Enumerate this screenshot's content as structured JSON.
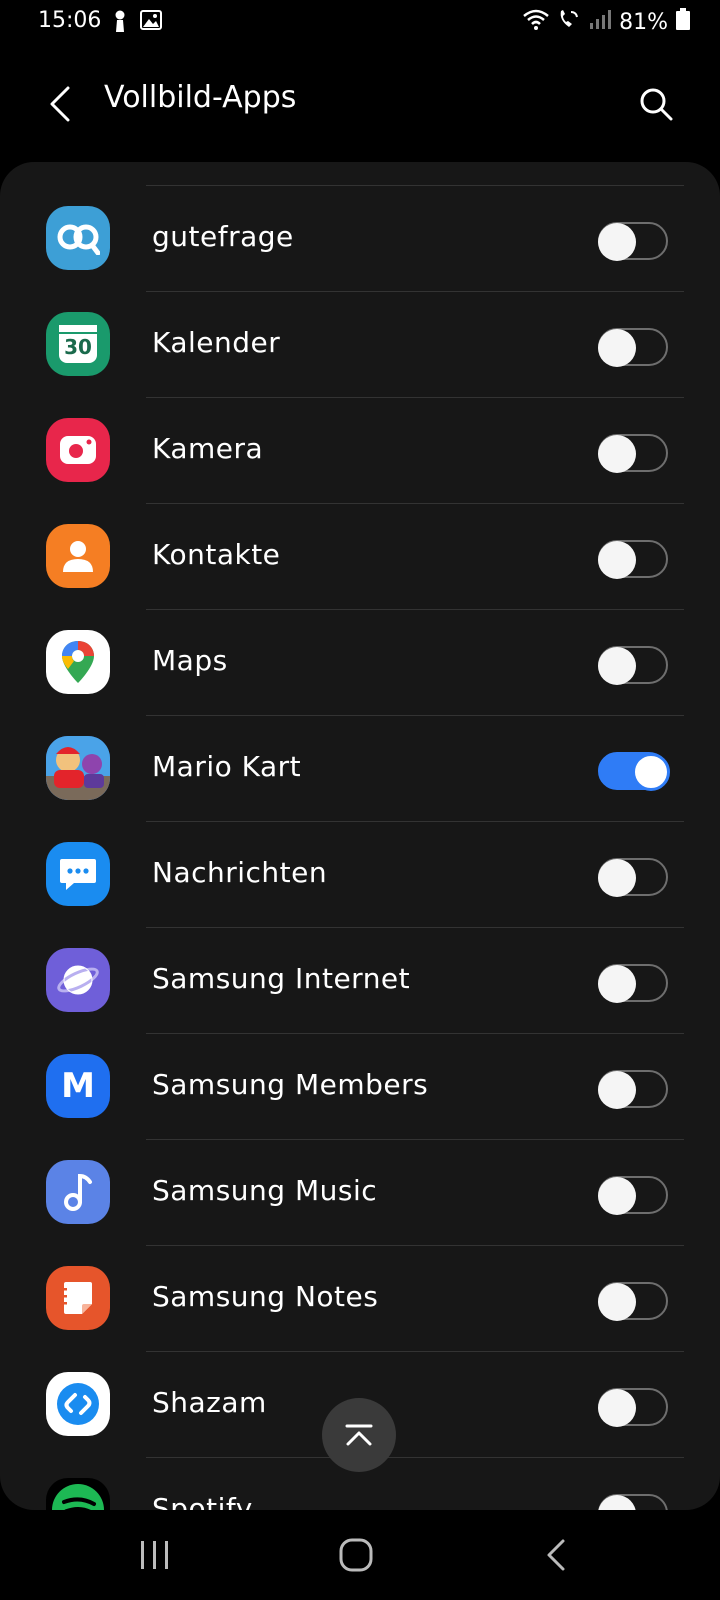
{
  "status_bar": {
    "time": "15:06",
    "battery": "81%",
    "icons": [
      "person-icon",
      "image-icon",
      "wifi-icon",
      "wifi-call-icon",
      "signal-icon",
      "battery-icon"
    ]
  },
  "header": {
    "title": "Vollbild-Apps",
    "back_icon": "chevron-left-icon",
    "search_icon": "search-icon"
  },
  "apps": [
    {
      "label": "gutefrage",
      "icon": "gutefrage-icon",
      "enabled": false
    },
    {
      "label": "Kalender",
      "icon": "calendar-icon",
      "icon_text": "30",
      "enabled": false
    },
    {
      "label": "Kamera",
      "icon": "camera-icon",
      "enabled": false
    },
    {
      "label": "Kontakte",
      "icon": "contacts-icon",
      "enabled": false
    },
    {
      "label": "Maps",
      "icon": "maps-icon",
      "enabled": false
    },
    {
      "label": "Mario Kart",
      "icon": "mario-kart-icon",
      "enabled": true
    },
    {
      "label": "Nachrichten",
      "icon": "messages-icon",
      "enabled": false
    },
    {
      "label": "Samsung Internet",
      "icon": "samsung-internet-icon",
      "enabled": false
    },
    {
      "label": "Samsung Members",
      "icon": "samsung-members-icon",
      "icon_text": "M",
      "enabled": false
    },
    {
      "label": "Samsung Music",
      "icon": "samsung-music-icon",
      "enabled": false
    },
    {
      "label": "Samsung Notes",
      "icon": "samsung-notes-icon",
      "enabled": false
    },
    {
      "label": "Shazam",
      "icon": "shazam-icon",
      "enabled": false
    },
    {
      "label": "Spotify",
      "icon": "spotify-icon",
      "enabled": false
    }
  ],
  "colors": {
    "accent": "#2f7cf6",
    "background": "#000000",
    "card": "#171717"
  },
  "scroll_top_icon": "chevron-up-bar-icon",
  "nav_bar": {
    "recents_icon": "recents-icon",
    "home_icon": "home-icon",
    "back_icon": "back-icon"
  }
}
